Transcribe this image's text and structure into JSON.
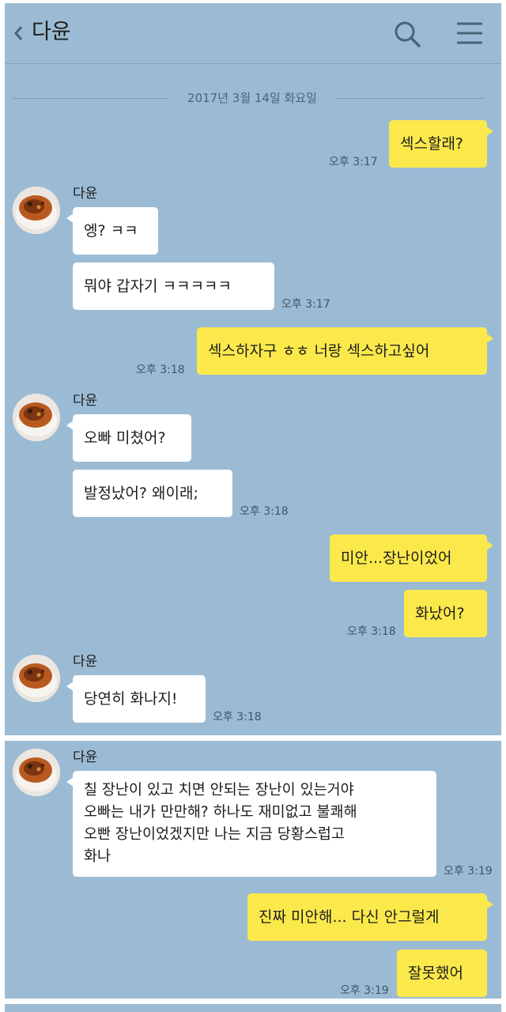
{
  "header": {
    "title": "다윤",
    "back_icon": "chevron-left-icon",
    "search_icon": "search-icon",
    "menu_icon": "hamburger-menu-icon"
  },
  "date_divider": "2017년 3월 14일 화요일",
  "colors": {
    "chat_background": "#9bbbd4",
    "my_bubble": "#fbe94c",
    "their_bubble": "#ffffff"
  },
  "messages": [
    {
      "from": "me",
      "text": "섹스할래?",
      "time": "오후 3:17"
    },
    {
      "from": "다윤",
      "sender_label": "다윤",
      "text": "엥? ㅋㅋ"
    },
    {
      "from": "다윤",
      "text": "뭐야 갑자기 ㅋㅋㅋㅋㅋ",
      "time": "오후 3:17"
    },
    {
      "from": "me",
      "text": "섹스하자구 ㅎㅎ 너랑 섹스하고싶어",
      "time": "오후 3:18"
    },
    {
      "from": "다윤",
      "sender_label": "다윤",
      "text": "오빠 미쳤어?"
    },
    {
      "from": "다윤",
      "text": "발정났어? 왜이래;",
      "time": "오후 3:18"
    },
    {
      "from": "me",
      "text": "미안...장난이었어"
    },
    {
      "from": "me",
      "text": "화났어?",
      "time": "오후 3:18"
    },
    {
      "from": "다윤",
      "sender_label": "다윤",
      "text": "당연히 화나지!",
      "time": "오후 3:18"
    },
    {
      "from": "다윤",
      "sender_label": "다윤",
      "text": "칠 장난이 있고 치면 안되는 장난이 있는거야\n오빠는 내가 만만해? 하나도 재미없고 불쾌해\n오빤 장난이었겠지만 나는 지금 당황스럽고\n화나",
      "time": "오후 3:19"
    },
    {
      "from": "me",
      "text": "진짜 미안해... 다신 안그럴게"
    },
    {
      "from": "me",
      "text": "잘못했어",
      "time": "오후 3:19"
    }
  ]
}
